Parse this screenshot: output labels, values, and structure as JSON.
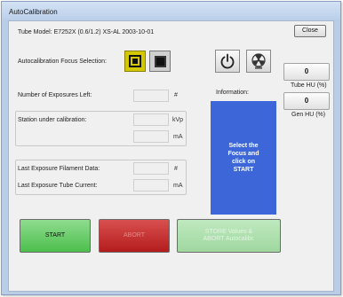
{
  "window": {
    "title": "AutoCalibration"
  },
  "header": {
    "tube_model": "Tube Model: E7252X (0.6/1.2) XS-AL 2003-10-01",
    "close_label": "Close"
  },
  "focus": {
    "label": "Autocalibration Focus Selection:",
    "large_icon": "large-focus-icon",
    "small_icon": "small-focus-icon",
    "selected": "large"
  },
  "tools": {
    "power_icon": "power-icon",
    "radiation_icon": "radiation-tube-icon"
  },
  "exposures": {
    "label": "Number of Exposures Left:",
    "value": "",
    "unit": "#"
  },
  "station": {
    "label": "Station under calibration:",
    "kvp_value": "",
    "kvp_unit": "kVp",
    "ma_value": "",
    "ma_unit": "mA"
  },
  "last_exposure": {
    "filament_label": "Last Exposure Filament Data:",
    "filament_value": "",
    "filament_unit": "#",
    "tube_current_label": "Last Exposure Tube Current:",
    "tube_current_value": "",
    "tube_current_unit": "mA"
  },
  "information": {
    "label": "Information:",
    "message": "Select the\nFocus and\nclick on\nSTART"
  },
  "gauges": {
    "tube_hu_value": "0",
    "tube_hu_label": "Tube HU (%)",
    "gen_hu_value": "0",
    "gen_hu_label": "Gen HU (%)"
  },
  "actions": {
    "start_label": "START",
    "abort_label": "ABORT",
    "store_label": "STORE Values &\nABORT Autocalibr."
  },
  "colors": {
    "focus_selected": "#d4c800",
    "info_panel": "#3d67d8",
    "start": "#4cbf4c",
    "abort": "#b41c1c",
    "store": "#9fd79f"
  }
}
